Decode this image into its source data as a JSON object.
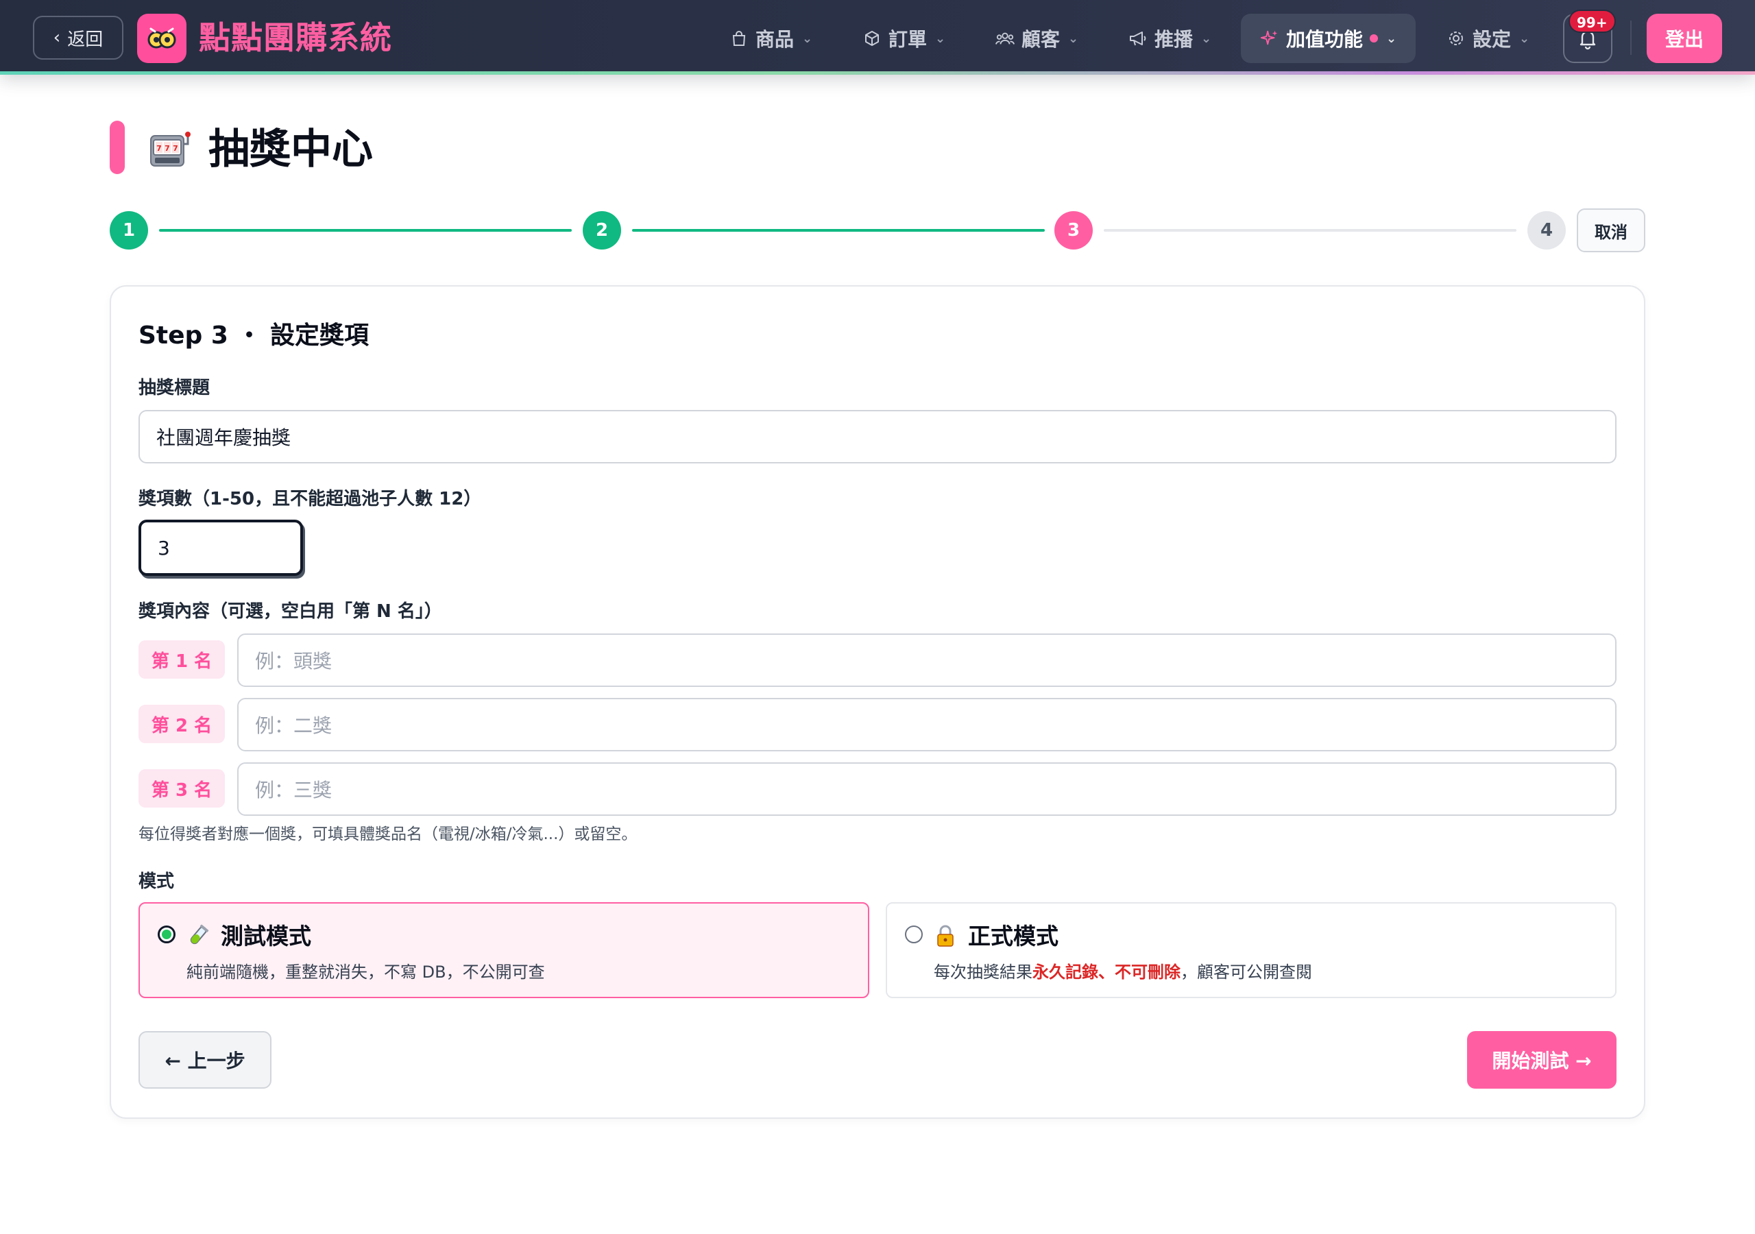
{
  "nav": {
    "back_label": "返回",
    "brand": "點點團購系統",
    "items": [
      {
        "label": "商品",
        "icon": "shopping-bag-icon"
      },
      {
        "label": "訂單",
        "icon": "box-icon"
      },
      {
        "label": "顧客",
        "icon": "users-icon"
      },
      {
        "label": "推播",
        "icon": "megaphone-icon"
      },
      {
        "label": "加值功能",
        "icon": "sparkles-icon",
        "active": true
      },
      {
        "label": "設定",
        "icon": "gear-icon"
      }
    ],
    "notification_badge": "99+",
    "logout_label": "登出"
  },
  "page": {
    "title": "抽獎中心",
    "title_icon": "slot-machine-icon"
  },
  "stepper": {
    "steps": [
      {
        "number": "1",
        "state": "done"
      },
      {
        "number": "2",
        "state": "done"
      },
      {
        "number": "3",
        "state": "current"
      },
      {
        "number": "4",
        "state": "todo"
      }
    ],
    "cancel_label": "取消"
  },
  "form": {
    "step_heading": "Step 3 ・ 設定獎項",
    "title_label": "抽獎標題",
    "title_value": "社團週年慶抽獎",
    "count_label": "獎項數（1-50，且不能超過池子人數 12）",
    "count_value": "3",
    "prizes_label": "獎項內容（可選，空白用「第 N 名」）",
    "prizes": [
      {
        "rank": "第 1 名",
        "placeholder": "例：頭獎"
      },
      {
        "rank": "第 2 名",
        "placeholder": "例：二獎"
      },
      {
        "rank": "第 3 名",
        "placeholder": "例：三獎"
      }
    ],
    "prizes_hint": "每位得獎者對應一個獎，可填具體獎品名（電視/冰箱/冷氣...）或留空。",
    "mode_label": "模式",
    "modes": [
      {
        "icon": "test-tube-icon",
        "title": "測試模式",
        "desc": "純前端隨機，重整就消失，不寫 DB，不公開可查",
        "selected": true
      },
      {
        "icon": "lock-icon",
        "title": "正式模式",
        "desc_before": "每次抽獎結果",
        "desc_warning": "永久記錄、不可刪除",
        "desc_after": "，顧客可公開查閱",
        "selected": false
      }
    ],
    "prev_label": "← 上一步",
    "start_label": "開始測試 →"
  },
  "colors": {
    "accent_pink": "#ff5fa2",
    "done_green": "#10b981",
    "warning_red": "#dc2626",
    "nav_bg": "#2c3349"
  }
}
